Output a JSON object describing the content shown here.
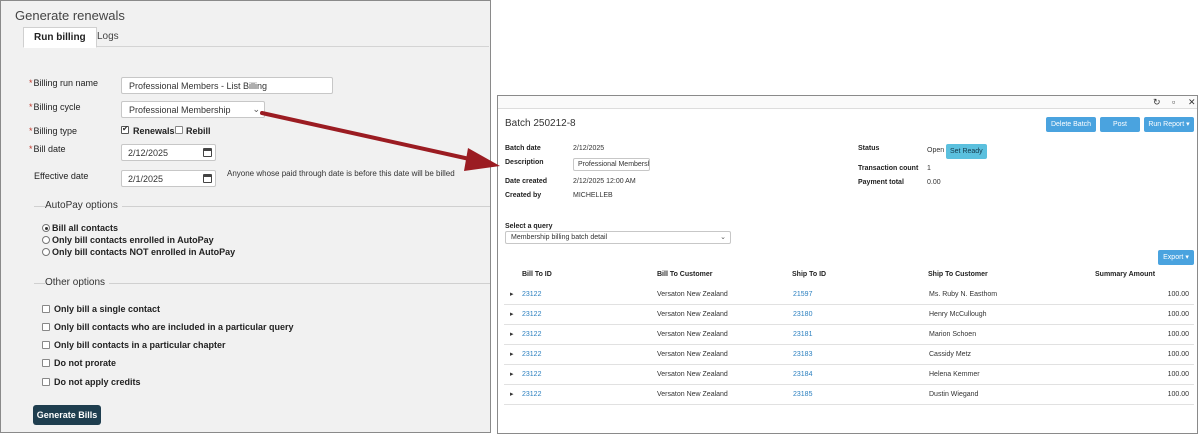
{
  "left": {
    "title": "Generate renewals",
    "tabs": [
      {
        "label": "Run billing"
      },
      {
        "label": "Logs"
      }
    ],
    "fields": {
      "run_name": {
        "label": "Billing run name",
        "value": "Professional Members - List Billing"
      },
      "cycle": {
        "label": "Billing cycle",
        "value": "Professional Membership"
      },
      "type": {
        "label": "Billing type",
        "renewals": "Renewals",
        "rebill": "Rebill"
      },
      "bill_date": {
        "label": "Bill date",
        "value": "2/12/2025"
      },
      "effective_date": {
        "label": "Effective date",
        "value": "2/1/2025",
        "note": "Anyone whose paid through date is before this date will be billed"
      }
    },
    "autopay": {
      "title": "AutoPay options",
      "options": [
        "Bill all contacts",
        "Only bill contacts enrolled in AutoPay",
        "Only bill contacts NOT enrolled in AutoPay"
      ]
    },
    "other": {
      "title": "Other options",
      "options": [
        "Only bill a single contact",
        "Only bill contacts who are included in a particular query",
        "Only bill contacts in a particular chapter",
        "Do not prorate",
        "Do not apply credits"
      ]
    },
    "generate_label": "Generate Bills"
  },
  "right": {
    "title": "Batch 250212-8",
    "buttons": {
      "delete": "Delete Batch",
      "post": "Post Batch",
      "report": "Run Report ▾"
    },
    "info": {
      "batch_date_label": "Batch date",
      "batch_date": "2/12/2025",
      "description_label": "Description",
      "description": "Professional Membersh",
      "created_label": "Date created",
      "created": "2/12/2025 12:00 AM",
      "created_by_label": "Created by",
      "created_by": "MICHELLEB",
      "status_label": "Status",
      "status": "Open",
      "set_ready": "Set Ready",
      "tx_label": "Transaction count",
      "tx": "1",
      "pay_label": "Payment total",
      "pay": "0.00"
    },
    "query": {
      "label": "Select a query",
      "value": "Membership billing batch detail"
    },
    "export_label": "Export ▾",
    "columns": [
      "Bill To ID",
      "Bill To Customer",
      "Ship To ID",
      "Ship To Customer",
      "Summary Amount"
    ],
    "rows": [
      {
        "bill_id": "23122",
        "bill_cust": "Versaton New Zealand",
        "ship_id": "21597",
        "ship_cust": "Ms. Ruby N. Easthom",
        "amount": "100.00"
      },
      {
        "bill_id": "23122",
        "bill_cust": "Versaton New Zealand",
        "ship_id": "23180",
        "ship_cust": "Henry McCullough",
        "amount": "100.00"
      },
      {
        "bill_id": "23122",
        "bill_cust": "Versaton New Zealand",
        "ship_id": "23181",
        "ship_cust": "Marion Schoen",
        "amount": "100.00"
      },
      {
        "bill_id": "23122",
        "bill_cust": "Versaton New Zealand",
        "ship_id": "23183",
        "ship_cust": "Cassidy Metz",
        "amount": "100.00"
      },
      {
        "bill_id": "23122",
        "bill_cust": "Versaton New Zealand",
        "ship_id": "23184",
        "ship_cust": "Helena Kemmer",
        "amount": "100.00"
      },
      {
        "bill_id": "23122",
        "bill_cust": "Versaton New Zealand",
        "ship_id": "23185",
        "ship_cust": "Dustin Wiegand",
        "amount": "100.00"
      }
    ]
  },
  "colors": {
    "accent": "#4aa3df",
    "primary_dark": "#1f3e4f",
    "arrow": "#9b1c22",
    "link": "#2a7fbf"
  }
}
